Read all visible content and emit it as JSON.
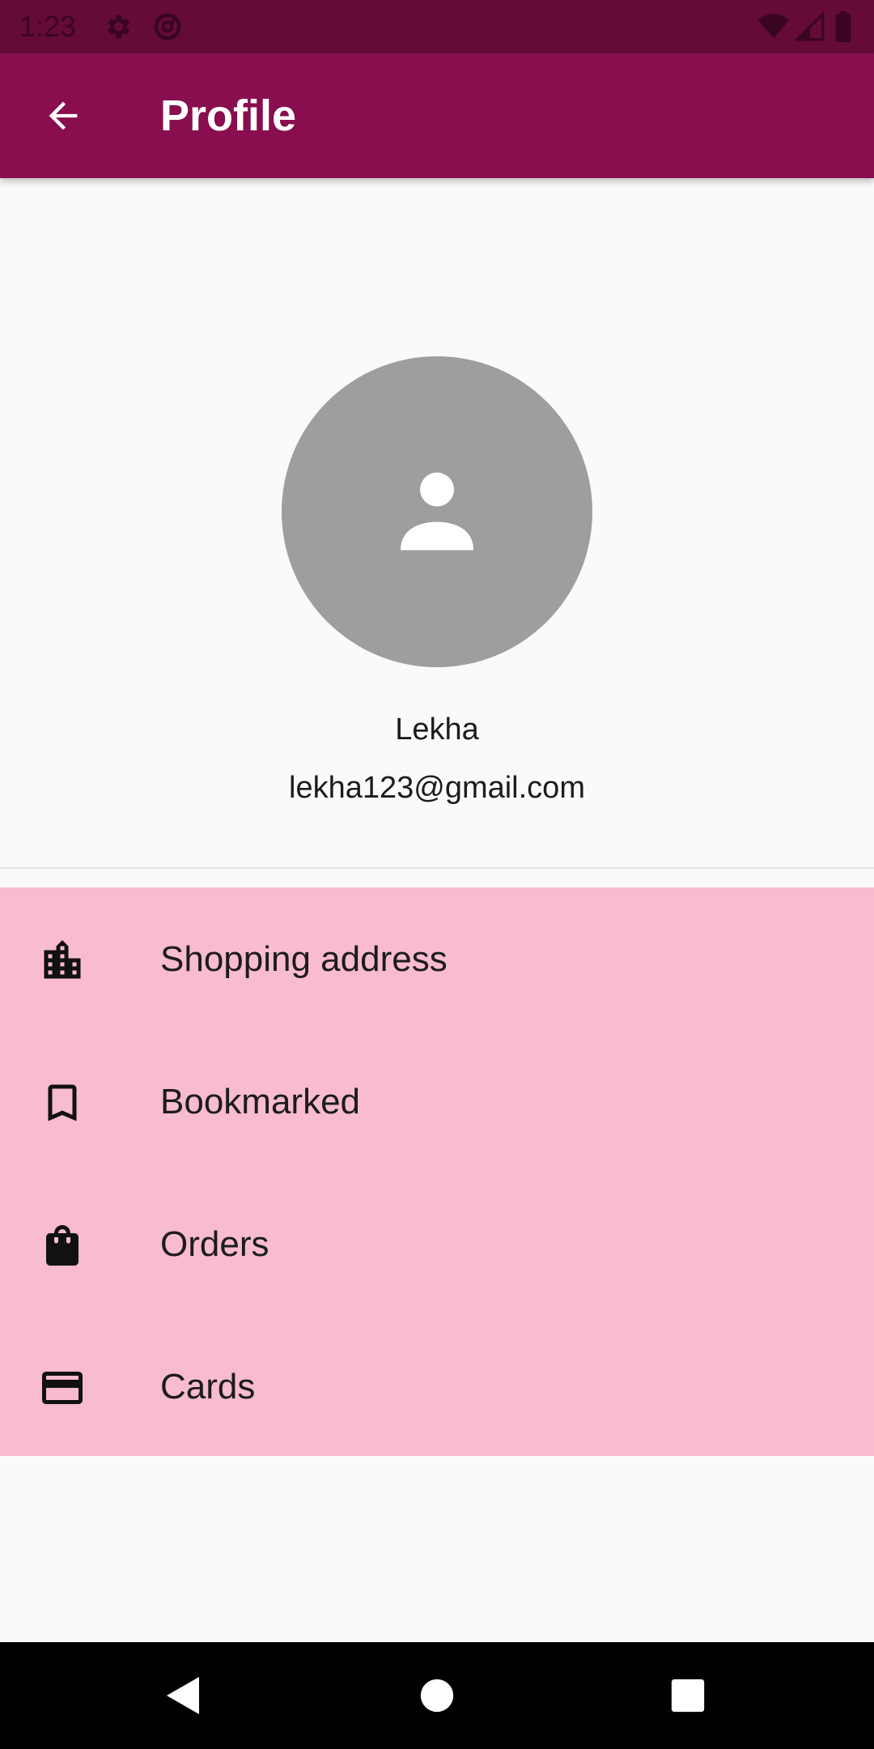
{
  "status_bar": {
    "time": "1:23",
    "icons": [
      "gear-icon",
      "at-sign-icon",
      "wifi-icon",
      "cell-signal-icon",
      "battery-icon"
    ]
  },
  "app_bar": {
    "title": "Profile",
    "back_icon": "arrow-back-icon"
  },
  "profile": {
    "avatar_icon": "person-icon",
    "name": "Lekha",
    "email": "lekha123@gmail.com"
  },
  "menu": {
    "items": [
      {
        "label": "Shopping address",
        "icon": "location-city-icon"
      },
      {
        "label": "Bookmarked",
        "icon": "bookmark-icon"
      },
      {
        "label": "Orders",
        "icon": "shopping-bag-icon"
      },
      {
        "label": "Cards",
        "icon": "credit-card-icon"
      }
    ]
  },
  "nav_bar": {
    "buttons": [
      "back-triangle-icon",
      "home-circle-icon",
      "recents-square-icon"
    ]
  },
  "colors": {
    "status_bar": "#640b38",
    "app_bar": "#880e4f",
    "menu_background": "#f8bbd0",
    "avatar": "#9e9e9e",
    "page_background": "#fafafa"
  }
}
